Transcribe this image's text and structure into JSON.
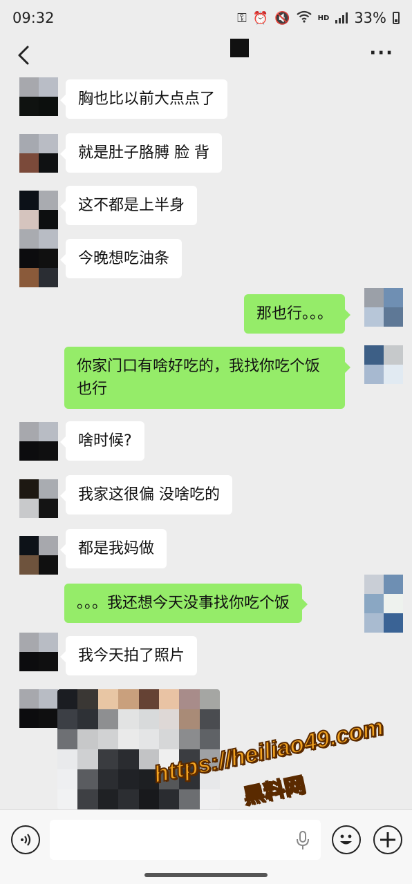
{
  "status_bar": {
    "time": "09:32",
    "hd": "HD",
    "battery_percent": "33%",
    "icons": [
      "key-icon",
      "alarm-icon",
      "mute-icon",
      "wifi-icon",
      "signal-icon",
      "battery-icon"
    ]
  },
  "nav": {
    "back_icon": "chevron-left-icon",
    "title": "",
    "more_icon": "more-dots-icon",
    "more_label": "···"
  },
  "messages": [
    {
      "side": "in",
      "text": "胸也比以前大点点了"
    },
    {
      "side": "in",
      "text": "就是肚子胳膊 脸 背"
    },
    {
      "side": "in",
      "text": "这不都是上半身"
    },
    {
      "side": "in",
      "text": "今晚想吃油条"
    },
    {
      "side": "out",
      "text": "那也行。。。"
    },
    {
      "side": "out",
      "text": "你家门口有啥好吃的，我找你吃个饭也行"
    },
    {
      "side": "in",
      "text": "啥时候?"
    },
    {
      "side": "in",
      "text": "我家这很偏 没啥吃的"
    },
    {
      "side": "in",
      "text": "都是我妈做"
    },
    {
      "side": "out",
      "text": "。。。我还想今天没事找你吃个饭"
    },
    {
      "side": "in",
      "text": "我今天拍了照片"
    },
    {
      "side": "in",
      "type": "image"
    }
  ],
  "watermark": {
    "url": "https://heiliao49.com",
    "name": "黑料网"
  },
  "input_bar": {
    "voice_icon": "voice-icon",
    "text_value": "",
    "mic_icon": "mic-icon",
    "emoji_icon": "emoji-icon",
    "plus_icon": "plus-icon"
  },
  "colors": {
    "background": "#ededed",
    "incoming_bubble": "#ffffff",
    "outgoing_bubble": "#95ec69",
    "watermark": "#f2a320"
  }
}
